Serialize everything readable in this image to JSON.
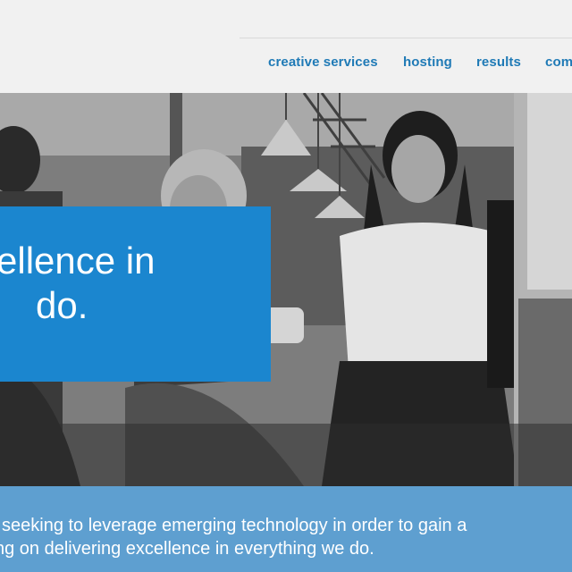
{
  "nav": {
    "items": [
      {
        "label": "creative services"
      },
      {
        "label": "hosting"
      },
      {
        "label": "results"
      },
      {
        "label": "com"
      }
    ]
  },
  "hero": {
    "title_line1": "ellence in",
    "title_line2": "do.",
    "accent_color": "#1b86cf"
  },
  "intro": {
    "line1": "seeking to leverage emerging technology in order to gain a",
    "line2": "ng on delivering excellence in everything we do.",
    "band_color": "#5e9fd0"
  },
  "colors": {
    "nav_link": "#1f7ab6",
    "header_bg": "#f1f1f1"
  }
}
